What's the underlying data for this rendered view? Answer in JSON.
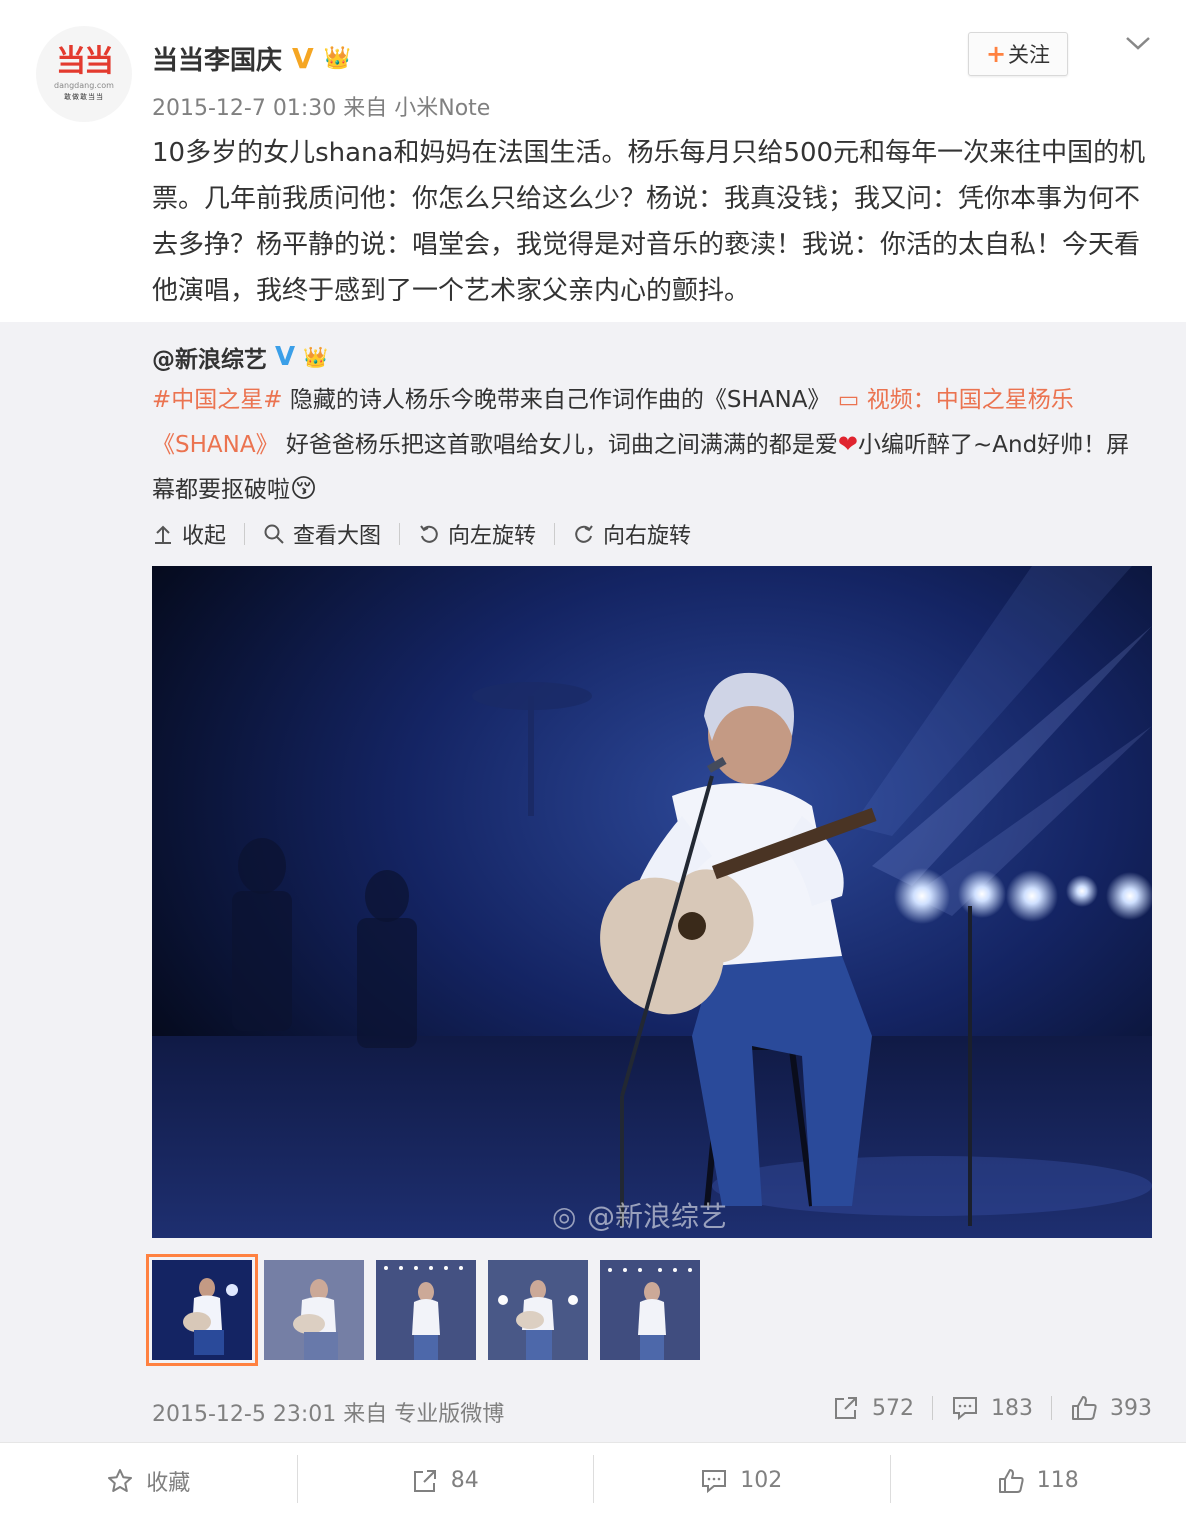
{
  "post": {
    "avatar": {
      "logo": "当当",
      "logo_sub": "dangdang.com",
      "logo_sub2": "敢做敢当当"
    },
    "author": "当当李国庆",
    "time": "2015-12-7 01:30",
    "source_prefix": "来自",
    "source": "小米Note",
    "follow_label": "关注",
    "text": "10多岁的女儿shana和妈妈在法国生活。杨乐每月只给500元和每年一次来往中国的机票。几年前我质问他：你怎么只给这么少？杨说：我真没钱；我又问：凭你本事为何不去多挣？杨平静的说：唱堂会，我觉得是对音乐的亵渎！我说：你活的太自私！今天看他演唱，我终于感到了一个艺术家父亲内心的颤抖。"
  },
  "repost": {
    "author": "@新浪综艺",
    "hashtag": "#中国之星#",
    "text_1": " 隐藏的诗人杨乐今晚带来自己作词作曲的《SHANA》 ",
    "video_link": "视频：中国之星杨乐《SHANA》",
    "text_2": " 好爸爸杨乐把这首歌唱给女儿，词曲之间满满的都是爱",
    "text_3": "小编听醉了~And好帅！屏幕都要抠破啦",
    "actions": {
      "collapse": "收起",
      "view_large": "查看大图",
      "rotate_left": "向左旋转",
      "rotate_right": "向右旋转"
    },
    "watermark": "@新浪综艺",
    "time": "2015-12-5 23:01",
    "source_prefix": "来自",
    "source": "专业版微博",
    "stats": {
      "reposts": "572",
      "comments": "183",
      "likes": "393"
    }
  },
  "bottom": {
    "favorite": "收藏",
    "reposts": "84",
    "comments": "102",
    "likes": "118"
  }
}
